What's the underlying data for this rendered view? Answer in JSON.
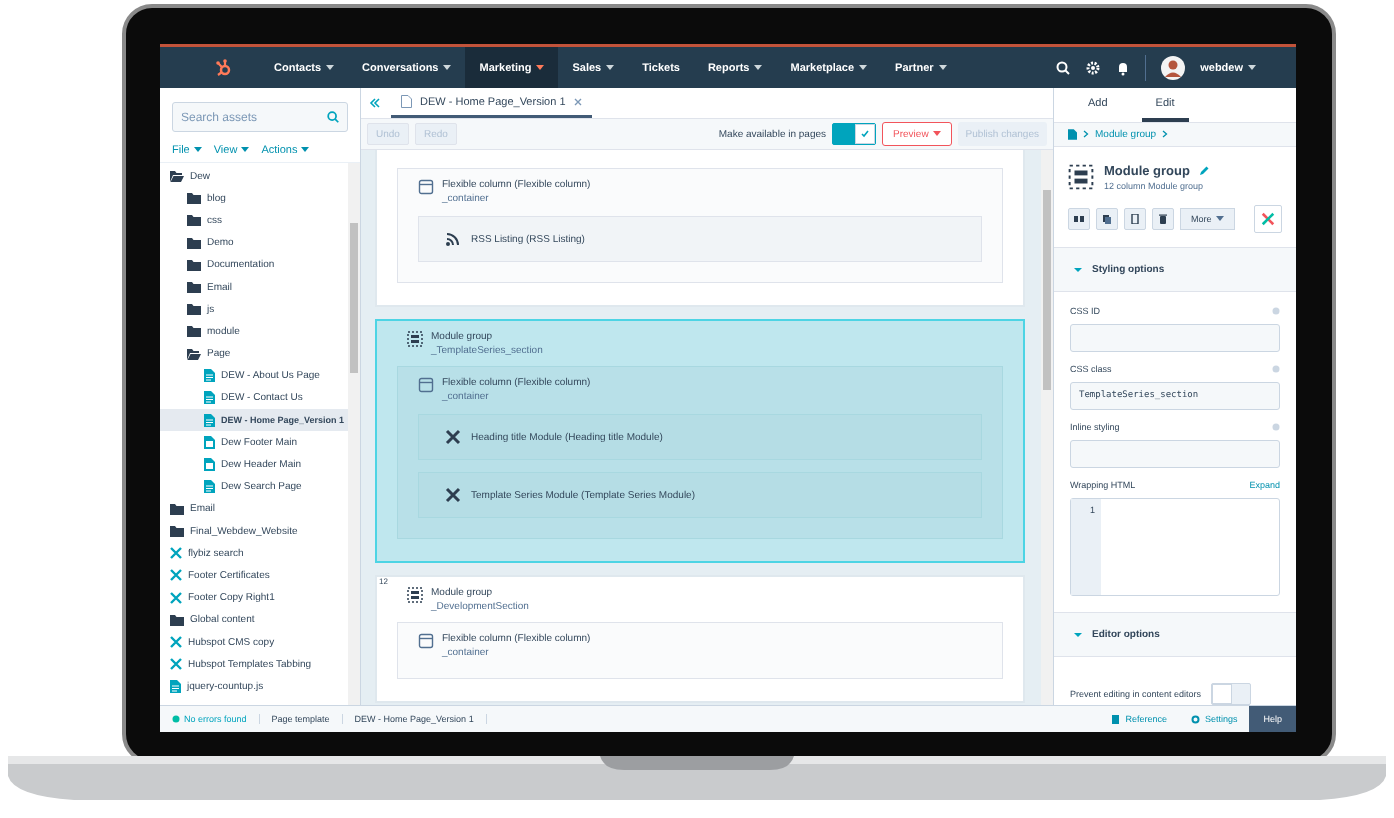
{
  "nav": {
    "items": [
      {
        "label": "Contacts",
        "has_menu": true,
        "selected": false
      },
      {
        "label": "Conversations",
        "has_menu": true,
        "selected": false
      },
      {
        "label": "Marketing",
        "has_menu": true,
        "selected": true
      },
      {
        "label": "Sales",
        "has_menu": true,
        "selected": false
      },
      {
        "label": "Tickets",
        "has_menu": false,
        "selected": false
      },
      {
        "label": "Reports",
        "has_menu": true,
        "selected": false
      },
      {
        "label": "Marketplace",
        "has_menu": true,
        "selected": false
      },
      {
        "label": "Partner",
        "has_menu": true,
        "selected": false
      }
    ],
    "user": "webdew"
  },
  "sidebar": {
    "search": {
      "placeholder": "Search assets"
    },
    "menus": [
      "File",
      "View",
      "Actions"
    ],
    "tree": [
      {
        "kind": "folder",
        "label": "Dew",
        "expanded": true,
        "selected": false,
        "children": [
          {
            "kind": "folder",
            "label": "blog",
            "expanded": false,
            "selected": false
          },
          {
            "kind": "folder",
            "label": "css",
            "expanded": false,
            "selected": false
          },
          {
            "kind": "folder",
            "label": "Demo",
            "expanded": false,
            "selected": false
          },
          {
            "kind": "folder",
            "label": "Documentation",
            "expanded": false,
            "selected": false
          },
          {
            "kind": "folder",
            "label": "Email",
            "expanded": false,
            "selected": false
          },
          {
            "kind": "folder",
            "label": "js",
            "expanded": false,
            "selected": false
          },
          {
            "kind": "folder",
            "label": "module",
            "expanded": false,
            "selected": false
          },
          {
            "kind": "folder",
            "label": "Page",
            "expanded": true,
            "selected": false,
            "children": [
              {
                "kind": "page",
                "label": "DEW - About Us Page",
                "selected": false
              },
              {
                "kind": "page",
                "label": "DEW - Contact Us",
                "selected": false
              },
              {
                "kind": "page",
                "label": "DEW - Home Page_Version 1",
                "selected": true
              },
              {
                "kind": "template",
                "label": "Dew Footer Main",
                "selected": false
              },
              {
                "kind": "template",
                "label": "Dew Header Main",
                "selected": false
              },
              {
                "kind": "page",
                "label": "Dew Search Page",
                "selected": false
              }
            ]
          }
        ]
      },
      {
        "kind": "folder",
        "label": "Email",
        "expanded": false,
        "selected": false
      },
      {
        "kind": "folder",
        "label": "Final_Webdew_Website",
        "expanded": false,
        "selected": false
      },
      {
        "kind": "module",
        "label": "flybiz search",
        "selected": false
      },
      {
        "kind": "module",
        "label": "Footer Certificates",
        "selected": false
      },
      {
        "kind": "module",
        "label": "Footer Copy Right1",
        "selected": false
      },
      {
        "kind": "folder",
        "label": "Global content",
        "expanded": false,
        "selected": false
      },
      {
        "kind": "module",
        "label": "Hubspot CMS copy",
        "selected": false
      },
      {
        "kind": "module",
        "label": "Hubspot Templates Tabbing",
        "selected": false
      },
      {
        "kind": "file",
        "label": "jquery-countup.js",
        "selected": false
      }
    ]
  },
  "tab": {
    "title": "DEW - Home Page_Version 1"
  },
  "toolbar": {
    "undo": "Undo",
    "redo": "Redo",
    "available_label": "Make available in pages",
    "available_on": true,
    "preview": "Preview",
    "publish": "Publish changes"
  },
  "canvas": {
    "sections": [
      {
        "selected": false,
        "children": [
          {
            "kind": "column",
            "title": "Flexible column (Flexible column)",
            "subtitle": "_container",
            "children": [
              {
                "kind": "rss",
                "title": "RSS Listing (RSS Listing)"
              }
            ]
          }
        ]
      },
      {
        "selected": true,
        "kind": "group",
        "title": "Module group",
        "subtitle": "_TemplateSeries_section",
        "children": [
          {
            "kind": "column",
            "title": "Flexible column (Flexible column)",
            "subtitle": "_container",
            "children": [
              {
                "kind": "module",
                "title": "Heading title Module (Heading title Module)"
              },
              {
                "kind": "module",
                "title": "Template Series Module (Template Series Module)"
              }
            ]
          }
        ]
      },
      {
        "selected": false,
        "number": "12",
        "kind": "group",
        "title": "Module group",
        "subtitle": "_DevelopmentSection",
        "children": [
          {
            "kind": "column",
            "title": "Flexible column (Flexible column)",
            "subtitle": "_container"
          }
        ]
      }
    ]
  },
  "panel": {
    "tabs": [
      {
        "label": "Add",
        "selected": false
      },
      {
        "label": "Edit",
        "selected": true
      }
    ],
    "breadcrumb": "Module group",
    "title": "Module group",
    "subtitle": "12 column Module group",
    "more": "More",
    "styling": {
      "title": "Styling options",
      "expanded": true,
      "fields": [
        {
          "label": "CSS ID"
        },
        {
          "label": "CSS class",
          "value": "TemplateSeries_section"
        },
        {
          "label": "Inline styling"
        }
      ],
      "wrapping": {
        "label": "Wrapping HTML",
        "expand": "Expand",
        "line": "1"
      }
    },
    "editor": {
      "title": "Editor options",
      "expanded": true,
      "prevent_label": "Prevent editing in content editors",
      "prevent_on": false
    }
  },
  "status": {
    "errors": "No errors found",
    "left": [
      "Page template",
      "DEW - Home Page_Version 1"
    ],
    "right": [
      {
        "kind": "reference",
        "label": "Reference"
      },
      {
        "kind": "settings",
        "label": "Settings"
      },
      {
        "kind": "help",
        "label": "Help"
      }
    ]
  }
}
